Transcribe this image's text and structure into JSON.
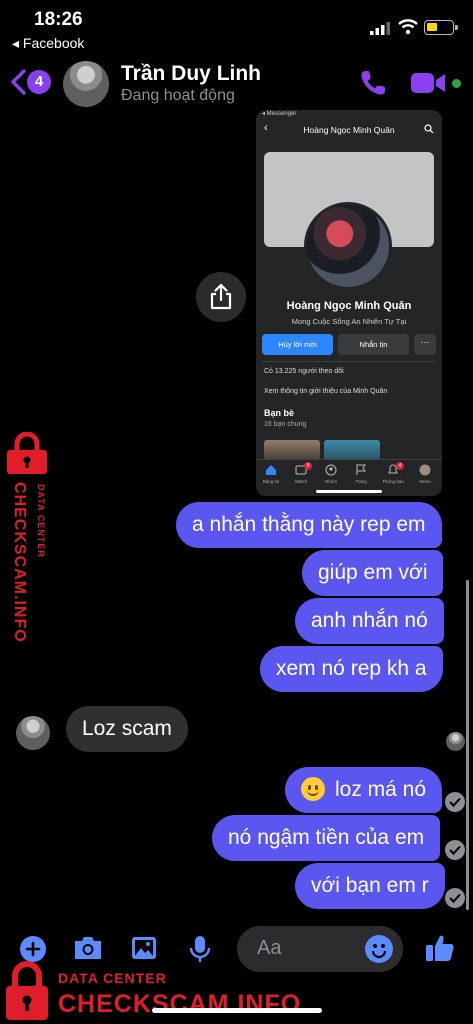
{
  "status_bar": {
    "time": "18:26",
    "back_app": "◂ Facebook"
  },
  "header": {
    "unread_count": "4",
    "contact_name": "Trần Duy Linh",
    "contact_status": "Đang hoạt động"
  },
  "shared_image": {
    "status": "◂ Messenger",
    "title": "Hoàng Ngọc Minh Quân",
    "profile_name": "Hoàng Ngọc Minh Quân",
    "bio": "Mong Cuộc Sống An Nhiên Tự Tại",
    "cancel_request_label": "Hủy lời mời",
    "message_label": "Nhắn tin",
    "more_label": "···",
    "followers": "Có 13.225 người theo dõi",
    "about": "Xem thông tin giới thiệu của Minh Quân",
    "friends_title": "Bạn bè",
    "mutual_friends": "16 bạn chung",
    "nav": [
      {
        "label": "Bảng tin",
        "badge": ""
      },
      {
        "label": "Watch",
        "badge": "9"
      },
      {
        "label": "Nhóm",
        "badge": ""
      },
      {
        "label": "Trang",
        "badge": ""
      },
      {
        "label": "Thông báo",
        "badge": "4"
      },
      {
        "label": "Menu",
        "badge": ""
      }
    ]
  },
  "messages": [
    {
      "side": "out",
      "text": "a nhắn thằng này rep em"
    },
    {
      "side": "out",
      "text": "giúp em với"
    },
    {
      "side": "out",
      "text": "anh nhắn nó"
    },
    {
      "side": "out",
      "text": "xem nó rep kh a"
    },
    {
      "side": "in",
      "text": "Loz scam"
    },
    {
      "side": "out",
      "text": "loz má nó"
    },
    {
      "side": "out",
      "text": "nó ngậm tiền của em"
    },
    {
      "side": "out",
      "text": "với bạn em r"
    }
  ],
  "composer": {
    "placeholder": "Aa"
  },
  "watermark": {
    "brand": "CHECKSCAM.INFO",
    "tag": "DATA CENTER"
  },
  "colors": {
    "accent": "#8a3ff0",
    "outgoing_bubble": "#5b56f0",
    "incoming_bubble": "#303030",
    "watermark": "#e21d2b",
    "online": "#31a24c"
  }
}
